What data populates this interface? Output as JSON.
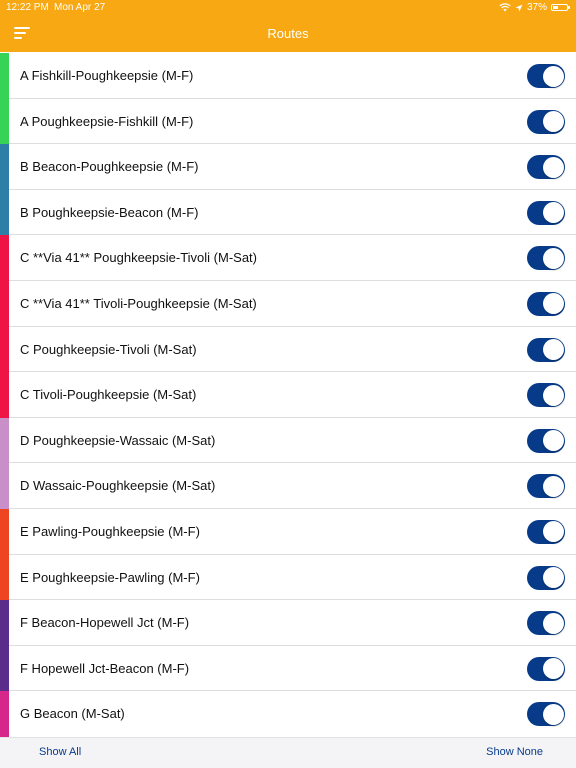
{
  "status_bar": {
    "time": "12:22 PM",
    "date": "Mon Apr 27",
    "battery_label": "37%",
    "battery_level": 0.37,
    "icons": [
      "wifi-icon",
      "location-arrow-icon",
      "battery-icon"
    ]
  },
  "header": {
    "title": "Routes",
    "menu_icon": "hamburger-menu-icon",
    "background_color": "#f7a812"
  },
  "routes": [
    {
      "label": "A Fishkill-Poughkeepsie (M-F)",
      "color": "#37d357",
      "enabled": true
    },
    {
      "label": "A Poughkeepsie-Fishkill (M-F)",
      "color": "#37d357",
      "enabled": true
    },
    {
      "label": "B Beacon-Poughkeepsie (M-F)",
      "color": "#2d7fa8",
      "enabled": true
    },
    {
      "label": "B Poughkeepsie-Beacon (M-F)",
      "color": "#2d7fa8",
      "enabled": true
    },
    {
      "label": "C **Via 41** Poughkeepsie-Tivoli (M-Sat)",
      "color": "#ee1445",
      "enabled": true
    },
    {
      "label": "C **Via 41** Tivoli-Poughkeepsie (M-Sat)",
      "color": "#ee1445",
      "enabled": true
    },
    {
      "label": "C Poughkeepsie-Tivoli (M-Sat)",
      "color": "#ee1445",
      "enabled": true
    },
    {
      "label": "C Tivoli-Poughkeepsie (M-Sat)",
      "color": "#ee1445",
      "enabled": true
    },
    {
      "label": "D Poughkeepsie-Wassaic (M-Sat)",
      "color": "#c98fc8",
      "enabled": true
    },
    {
      "label": "D Wassaic-Poughkeepsie (M-Sat)",
      "color": "#c98fc8",
      "enabled": true
    },
    {
      "label": "E Pawling-Poughkeepsie (M-F)",
      "color": "#ee4422",
      "enabled": true
    },
    {
      "label": "E Poughkeepsie-Pawling (M-F)",
      "color": "#ee4422",
      "enabled": true
    },
    {
      "label": "F Beacon-Hopewell Jct (M-F)",
      "color": "#5a2d8c",
      "enabled": true
    },
    {
      "label": "F Hopewell Jct-Beacon (M-F)",
      "color": "#5a2d8c",
      "enabled": true
    },
    {
      "label": "G Beacon (M-Sat)",
      "color": "#d6288a",
      "enabled": true
    }
  ],
  "toggle_on_color": "#073b8a",
  "footer": {
    "show_all_label": "Show All",
    "show_none_label": "Show None"
  }
}
